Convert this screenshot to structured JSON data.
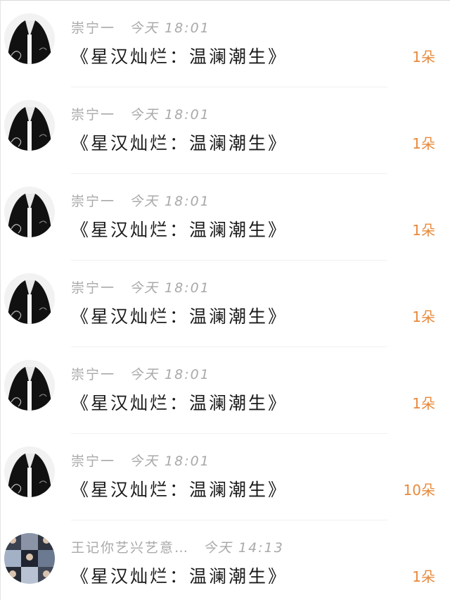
{
  "rows": [
    {
      "user": "崇宁一",
      "time": "今天 18:01",
      "title": "《星汉灿烂：温澜潮生》",
      "count": "1朵",
      "avatar": "black-robe-figure-avatar"
    },
    {
      "user": "崇宁一",
      "time": "今天 18:01",
      "title": "《星汉灿烂：温澜潮生》",
      "count": "1朵",
      "avatar": "black-robe-figure-avatar"
    },
    {
      "user": "崇宁一",
      "time": "今天 18:01",
      "title": "《星汉灿烂：温澜潮生》",
      "count": "1朵",
      "avatar": "black-robe-figure-avatar"
    },
    {
      "user": "崇宁一",
      "time": "今天 18:01",
      "title": "《星汉灿烂：温澜潮生》",
      "count": "1朵",
      "avatar": "black-robe-figure-avatar"
    },
    {
      "user": "崇宁一",
      "time": "今天 18:01",
      "title": "《星汉灿烂：温澜潮生》",
      "count": "1朵",
      "avatar": "black-robe-figure-avatar"
    },
    {
      "user": "崇宁一",
      "time": "今天 18:01",
      "title": "《星汉灿烂：温澜潮生》",
      "count": "10朵",
      "avatar": "black-robe-figure-avatar"
    },
    {
      "user": "王记你艺兴艺意…",
      "time": "今天 14:13",
      "title": "《星汉灿烂：温澜潮生》",
      "count": "1朵",
      "avatar": "photo-grid-avatar"
    }
  ],
  "colors": {
    "count": "#e8893b",
    "meta": "#a9a9a9",
    "title": "#1a1a1a"
  }
}
